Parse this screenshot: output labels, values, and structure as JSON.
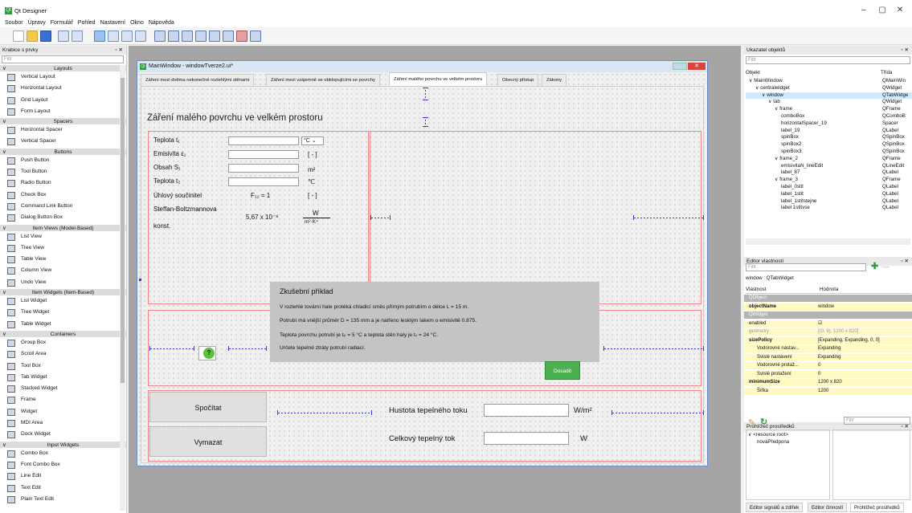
{
  "app": {
    "title": "Qt Designer",
    "icon": "qt-designer-icon",
    "controls": [
      "–",
      "▢",
      "✕"
    ]
  },
  "menu": [
    "Soubor",
    "Úpravy",
    "Formulář",
    "Pohled",
    "Nastavení",
    "Okno",
    "Nápověda"
  ],
  "widget_box": {
    "title": "Krabice s prvky",
    "filter_placeholder": "Filtr",
    "groups": [
      {
        "name": "Layouts",
        "items": [
          "Vertical Layout",
          "Horizontal Layout",
          "Grid Layout",
          "Form Layout"
        ]
      },
      {
        "name": "Spacers",
        "items": [
          "Horizontal Spacer",
          "Vertical Spacer"
        ]
      },
      {
        "name": "Buttons",
        "items": [
          "Push Button",
          "Tool Button",
          "Radio Button",
          "Check Box",
          "Command Link Button",
          "Dialog Button Box"
        ]
      },
      {
        "name": "Item Views (Model-Based)",
        "items": [
          "List View",
          "Tree View",
          "Table View",
          "Column View",
          "Undo View"
        ]
      },
      {
        "name": "Item Widgets (Item-Based)",
        "items": [
          "List Widget",
          "Tree Widget",
          "Table Widget"
        ]
      },
      {
        "name": "Containers",
        "items": [
          "Group Box",
          "Scroll Area",
          "Tool Box",
          "Tab Widget",
          "Stacked Widget",
          "Frame",
          "Widget",
          "MDI Area",
          "Dock Widget"
        ]
      },
      {
        "name": "Input Widgets",
        "items": [
          "Combo Box",
          "Font Combo Box",
          "Line Edit",
          "Text Edit",
          "Plain Text Edit"
        ]
      }
    ]
  },
  "form": {
    "window_title": "MainWindow - windowTverze2.ui*",
    "tabs": [
      "Záření mezi dvěma nekonečně rozlehlými stěnami",
      "Záření mezi vzájemně se obklopujícími se povrchy",
      "Záření malého povrchu ve velkém prostoru",
      "Obecný přístup",
      "Zákony"
    ],
    "heading": "Záření malého povrchu ve velkém prostoru",
    "labels": {
      "teplota1": "Teplota t₁",
      "emisivita": "Emisivita ε₁",
      "obsah": "Obsah S₁",
      "teplota2": "Teplota t₂",
      "uhlovy": "Úhlový součinitel",
      "sb1": "Steffan-Boltzmannova",
      "sb2": "konst."
    },
    "units": {
      "combo": "°C",
      "emis": "[ - ]",
      "area": "m²",
      "temp2": "℃",
      "f12": "[ - ]",
      "w": "W",
      "mk": "m²·K⁴"
    },
    "values": {
      "f12": "F₁₂ = 1",
      "sb": "5,67 x 10⁻⁸"
    },
    "example": {
      "title": "Zkušební příklad",
      "lines": [
        "V rozlehlé tovární hale protéká chladicí směs přímým potrubím o délce L = 15 m.",
        "Potrubí má vnější průměr D = 135 mm a je natřeno lesklým lakem o emisivitě 0.875.",
        "Teplota povrchu potrubí je tₚ = 5 °C a teplota stěn haly je tₛ = 24 °C.",
        "Určete tepelné ztráty potrubí radiací."
      ],
      "button": "Dosadit",
      "help": "?"
    },
    "results": {
      "compute": "Spočítat",
      "clear": "Vymazat",
      "flux": "Hustota tepelného toku",
      "flux_unit": "W/m²",
      "total": "Celkový tepelný tok",
      "total_unit": "W"
    }
  },
  "object_inspector": {
    "title": "Ukazatel objektů",
    "filter_placeholder": "Filtr",
    "col_object": "Objekt",
    "col_class": "Třída",
    "rows": [
      {
        "name": "MainWindow",
        "cls": "QMainWin",
        "indent": 0,
        "exp": "∨"
      },
      {
        "name": "centralwidget",
        "cls": "QWidget",
        "indent": 1,
        "exp": "∨"
      },
      {
        "name": "window",
        "cls": "QTabWidge",
        "indent": 2,
        "exp": "∨",
        "sel": true
      },
      {
        "name": "tab",
        "cls": "QWidget",
        "indent": 3,
        "exp": "∨"
      },
      {
        "name": "frame",
        "cls": "QFrame",
        "indent": 4,
        "exp": "∨"
      },
      {
        "name": "comboBox",
        "cls": "QComboB",
        "indent": 5
      },
      {
        "name": "horizontalSpacer_19",
        "cls": "Spacer",
        "indent": 5
      },
      {
        "name": "label_19",
        "cls": "QLabel",
        "indent": 5
      },
      {
        "name": "spinBox",
        "cls": "QSpinBox",
        "indent": 5
      },
      {
        "name": "spinBox2",
        "cls": "QSpinBox",
        "indent": 5
      },
      {
        "name": "spinBox3",
        "cls": "QSpinBox",
        "indent": 5
      },
      {
        "name": "frame_2",
        "cls": "QFrame",
        "indent": 4,
        "exp": "∨"
      },
      {
        "name": "emisivitaN_lineEdit",
        "cls": "QLineEdit",
        "indent": 5
      },
      {
        "name": "label_87",
        "cls": "QLabel",
        "indent": 5
      },
      {
        "name": "frame_3",
        "cls": "QFrame",
        "indent": 4,
        "exp": "∨"
      },
      {
        "name": "label_0stit",
        "cls": "QLabel",
        "indent": 5
      },
      {
        "name": "label_1stit",
        "cls": "QLabel",
        "indent": 5
      },
      {
        "name": "label_1stitstejne",
        "cls": "QLabel",
        "indent": 5
      },
      {
        "name": "label 1stitvse",
        "cls": "QLabel",
        "indent": 5
      }
    ]
  },
  "property_editor": {
    "title": "Editor vlastností",
    "filter_placeholder": "Filtr",
    "context": "window : QTabWidget",
    "col_prop": "Vlastnost",
    "col_val": "Hodnota",
    "rows": [
      {
        "p": "QObject",
        "v": "",
        "type": "group"
      },
      {
        "p": "objectName",
        "v": "window",
        "type": "bold"
      },
      {
        "p": "QWidget",
        "v": "",
        "type": "group"
      },
      {
        "p": "enabled",
        "v": "☑",
        "type": "plain"
      },
      {
        "p": "geometry",
        "v": "[(0, 9), 1200 x 820]",
        "type": "dim"
      },
      {
        "p": "sizePolicy",
        "v": "[Expanding, Expanding, 0, 0]",
        "type": "bold"
      },
      {
        "p": "Vodorovné nastav...",
        "v": "Expanding",
        "type": "sub"
      },
      {
        "p": "Svislé nastavení",
        "v": "Expanding",
        "type": "sub"
      },
      {
        "p": "Vodorovné protaž...",
        "v": "0",
        "type": "sub"
      },
      {
        "p": "Svislé protažení",
        "v": "0",
        "type": "sub"
      },
      {
        "p": "minimumSize",
        "v": "1200 x 820",
        "type": "bold"
      },
      {
        "p": "Šířka",
        "v": "1200",
        "type": "sub"
      }
    ]
  },
  "resource_browser": {
    "title": "Prohlížeč prostředků",
    "filter_placeholder": "Filtr",
    "root": "<resource root>",
    "child": "nováPředpona"
  },
  "bottom_tabs": [
    "Editor signálů a zdířek",
    "Editor činností",
    "Prohlížeč prostředků"
  ],
  "colors": {
    "selection": "#cde8ff",
    "frame_border": "#ee8888",
    "spacer": "#3a3ad8",
    "example_bg": "#c4c4c4",
    "accent_green": "#4caf50"
  }
}
